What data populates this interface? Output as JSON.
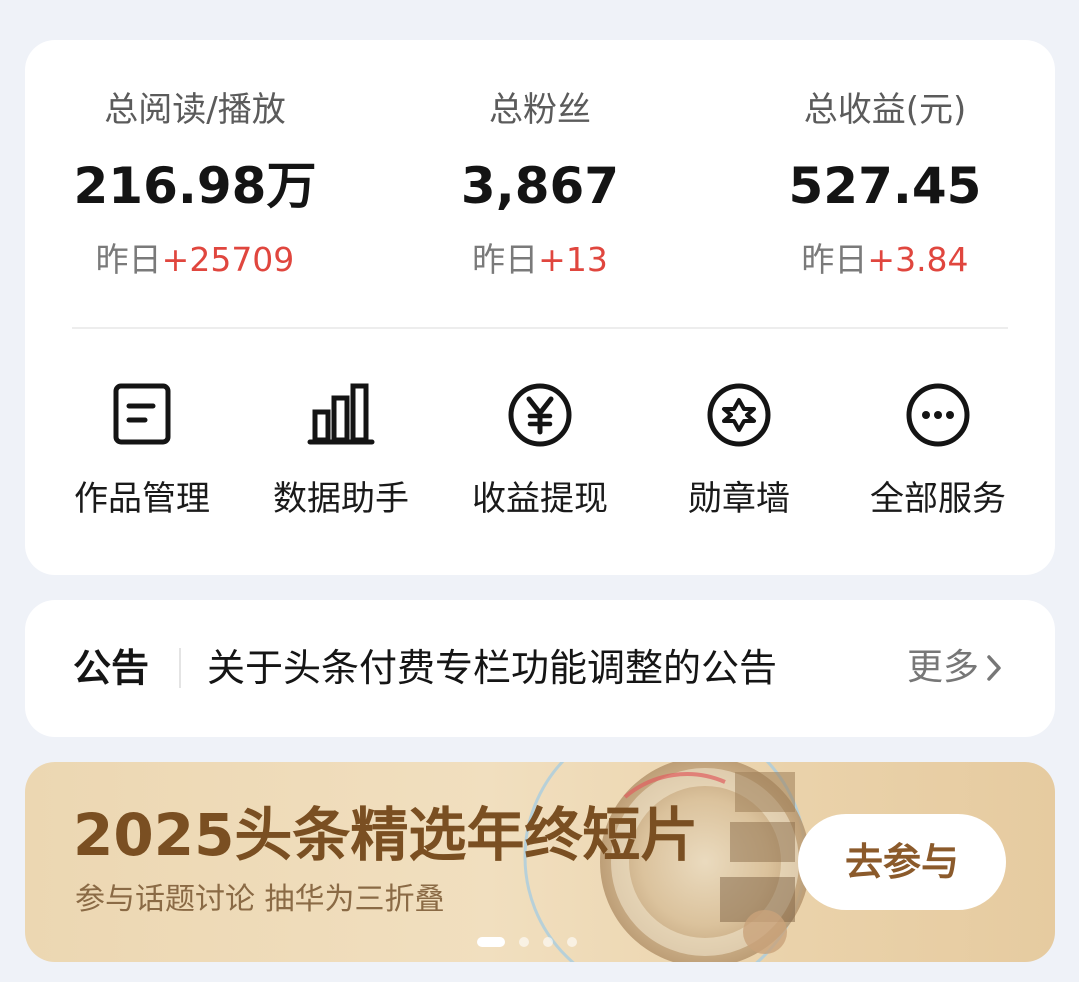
{
  "stats": [
    {
      "label": "总阅读/播放",
      "value": "216.98万",
      "change_prefix": "昨日",
      "change_value": "+25709"
    },
    {
      "label": "总粉丝",
      "value": "3,867",
      "change_prefix": "昨日",
      "change_value": "+13"
    },
    {
      "label": "总收益(元)",
      "value": "527.45",
      "change_prefix": "昨日",
      "change_value": "+3.84"
    }
  ],
  "services": [
    {
      "label": "作品管理",
      "icon": "document-icon"
    },
    {
      "label": "数据助手",
      "icon": "bar-chart-icon"
    },
    {
      "label": "收益提现",
      "icon": "yen-icon"
    },
    {
      "label": "勋章墙",
      "icon": "medal-star-icon"
    },
    {
      "label": "全部服务",
      "icon": "more-icon"
    }
  ],
  "notice": {
    "title": "公告",
    "text": "关于头条付费专栏功能调整的公告",
    "more_label": "更多"
  },
  "banner": {
    "title": "2025头条精选年终短片",
    "subtitle": "参与话题讨论 抽华为三折叠",
    "button_label": "去参与",
    "dots_total": 4,
    "active_dot": 1
  },
  "colors": {
    "background": "#eff2f8",
    "card": "#ffffff",
    "increase": "#e0463e",
    "banner_text": "#7a4f22",
    "banner_button_text": "#8b5a2b"
  }
}
